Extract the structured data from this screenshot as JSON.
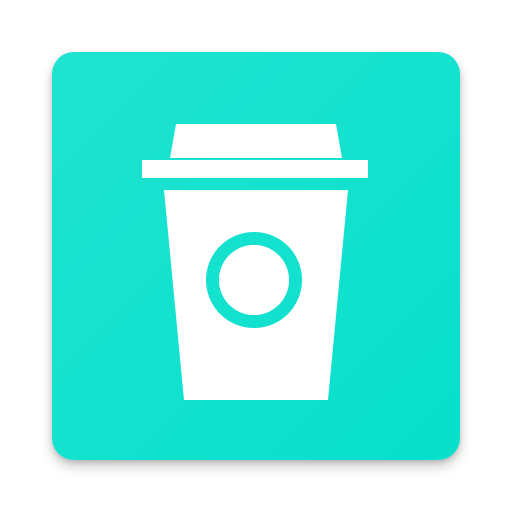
{
  "app_icon": {
    "name": "coffee-cup-app-icon",
    "icon": "coffee-cup-icon",
    "colors": {
      "background": "#07E0CC",
      "background_light": "#1FE3D0",
      "glyph": "#FFFFFF"
    }
  }
}
